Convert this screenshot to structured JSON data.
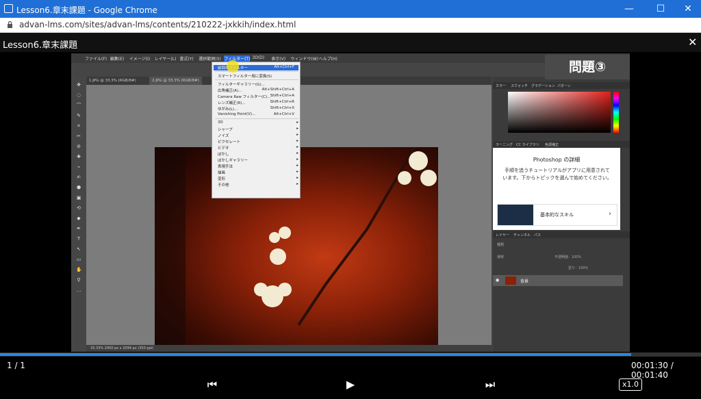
{
  "window": {
    "title": "Lesson6.章末課題 - Google Chrome",
    "url": "advan-lms.com/sites/advan-lms/contents/210222-jxkkih/index.html"
  },
  "player": {
    "title": "Lesson6.章末課題",
    "page": "1 / 1",
    "time": "00:01:30 / 00:01:40",
    "progress": 0.9,
    "speed": "x1.0"
  },
  "overlay": {
    "question": "問題③"
  },
  "ps": {
    "menus": [
      "ファイル(F)",
      "編集(E)",
      "イメージ(I)",
      "レイヤー(L)",
      "書式(Y)",
      "選択範囲(S)",
      "フィルター(T)",
      "3D(D)",
      "表示(V)",
      "ウィンドウ(W)",
      "ヘルプ(H)"
    ],
    "tabs": [
      "1.JPG @ 33.3% (RGB/8#)",
      "2.JPG @ 33.3% (RGB/8#)"
    ],
    "status": "33.33%     2950 px x 2094 px (350 ppi)",
    "filter_menu": [
      {
        "label": "前回のフィルター",
        "shortcut": "Alt+Ctrl+F"
      },
      {
        "label": "スマートフィルター用に変換(S)",
        "shortcut": ""
      },
      {
        "label": "フィルターギャラリー(G)...",
        "shortcut": ""
      },
      {
        "label": "広角補正(A)...",
        "shortcut": "Alt+Shift+Ctrl+A"
      },
      {
        "label": "Camera Raw フィルター(C)...",
        "shortcut": "Shift+Ctrl+A"
      },
      {
        "label": "レンズ補正(R)...",
        "shortcut": "Shift+Ctrl+R"
      },
      {
        "label": "ゆがみ(L)...",
        "shortcut": "Shift+Ctrl+X"
      },
      {
        "label": "Vanishing Point(V)...",
        "shortcut": "Alt+Ctrl+V"
      },
      {
        "label": "3D",
        "shortcut": "▸"
      },
      {
        "label": "シャープ",
        "shortcut": "▸"
      },
      {
        "label": "ノイズ",
        "shortcut": "▸"
      },
      {
        "label": "ピクセレート",
        "shortcut": "▸"
      },
      {
        "label": "ビデオ",
        "shortcut": "▸"
      },
      {
        "label": "ぼかし",
        "shortcut": "▸"
      },
      {
        "label": "ぼかしギャラリー",
        "shortcut": "▸"
      },
      {
        "label": "表現手法",
        "shortcut": "▸"
      },
      {
        "label": "描画",
        "shortcut": "▸"
      },
      {
        "label": "変形",
        "shortcut": "▸"
      },
      {
        "label": "その他",
        "shortcut": "▸"
      }
    ],
    "color_tabs": [
      "カラー",
      "スウォッチ",
      "グラデーション",
      "パターン"
    ],
    "learn_tabs": [
      "ラーニング",
      "CC ライブラリ",
      "色調補正"
    ],
    "learn_title": "Photoshop の詳細",
    "learn_text": "手順を追うチュートリアルがアプリに用意されています。下からトピックを選んで始めてください。",
    "learn_item": "基本的なスキル",
    "layer_tabs": [
      "レイヤー",
      "チャンネル",
      "パス"
    ],
    "layer_name": "背景",
    "opacity_label": "不透明度：100%",
    "fill_label": "塗り：100%",
    "blend": "通常",
    "kind": "種類"
  }
}
